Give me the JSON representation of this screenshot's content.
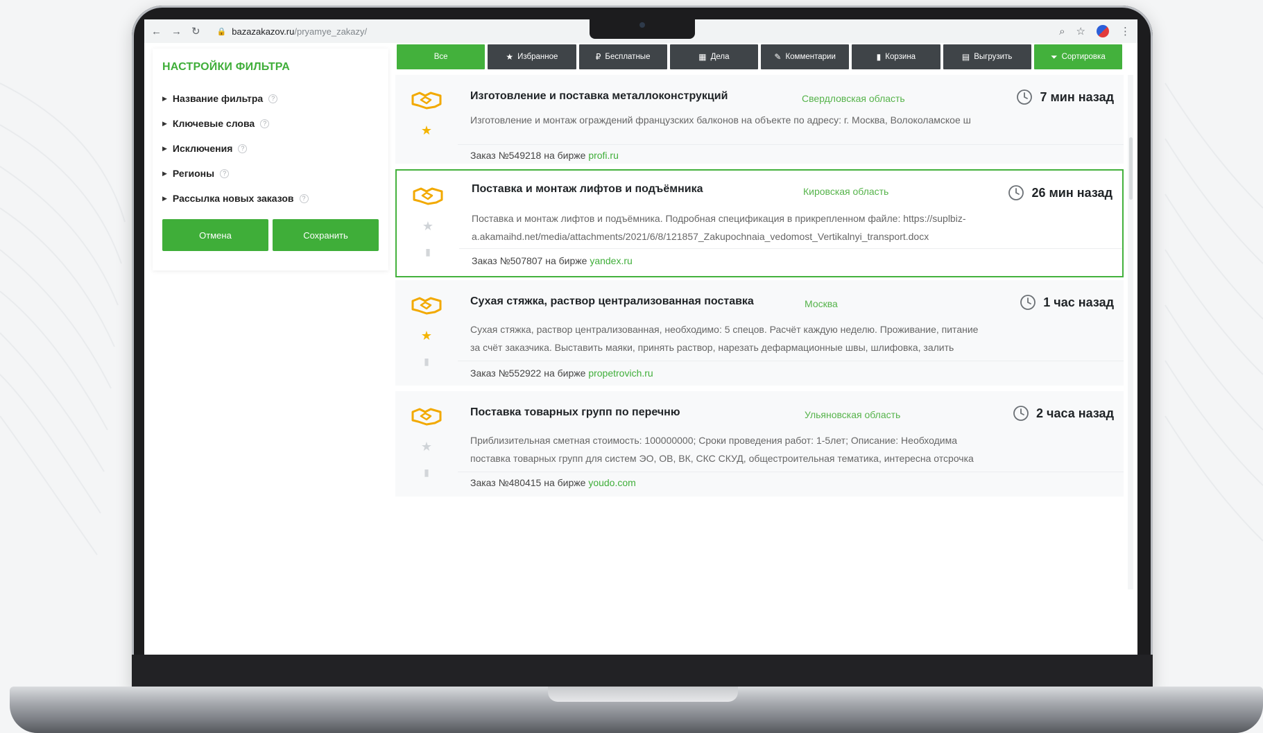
{
  "browser": {
    "url_host": "bazazakazov.ru",
    "url_path": "/pryamye_zakazy/"
  },
  "sidebar": {
    "title": "НАСТРОЙКИ ФИЛЬТРА",
    "items": [
      {
        "label": "Название фильтра"
      },
      {
        "label": "Ключевые слова"
      },
      {
        "label": "Исключения"
      },
      {
        "label": "Регионы"
      },
      {
        "label": "Рассылка новых заказов"
      }
    ],
    "cancel_label": "Отмена",
    "save_label": "Сохранить"
  },
  "toolbar": {
    "buttons": [
      {
        "label": "Все",
        "icon": ""
      },
      {
        "label": "Избранное",
        "icon": "star-icon"
      },
      {
        "label": "Бесплатные",
        "icon": "ruble-icon"
      },
      {
        "label": "Дела",
        "icon": "calendar-icon"
      },
      {
        "label": "Комментарии",
        "icon": "pencil-icon"
      },
      {
        "label": "Корзина",
        "icon": "trash-icon"
      },
      {
        "label": "Выгрузить",
        "icon": "document-icon"
      },
      {
        "label": "Сортировка",
        "icon": "filter-icon"
      }
    ]
  },
  "orders": [
    {
      "title": "Изготовление и поставка металлоконструкций",
      "region": "Свердловская область",
      "time": "7 мин назад",
      "desc_lines": [
        "Изготовление и монтаж ограждений французских балконов на объекте по адресу: г. Москва, Волоколамское ш"
      ],
      "foot_prefix": "Заказ №549218 на бирже ",
      "foot_link": "profi.ru",
      "starred": true
    },
    {
      "title": "Поставка и монтаж лифтов и подъёмника",
      "region": "Кировская область",
      "time": "26 мин назад",
      "desc_lines": [
        "Поставка и монтаж лифтов и подъёмника. Подробная спецификация в прикрепленном файле: https://suplbiz-",
        "a.akamaihd.net/media/attachments/2021/6/8/121857_Zakupochnaia_vedomost_Vertikalnyi_transport.docx"
      ],
      "foot_prefix": "Заказ №507807 на бирже ",
      "foot_link": "yandex.ru",
      "starred": false
    },
    {
      "title": "Сухая стяжка, раствор централизованная поставка",
      "region": "Москва",
      "time": "1 час назад",
      "desc_lines": [
        "Сухая стяжка, раствор централизованная, необходимо: 5 спецов. Расчёт каждую неделю. Проживание, питание",
        "за счёт заказчика. Выставить маяки, принять раствор, нарезать дефармационные швы, шлифовка, залить"
      ],
      "foot_prefix": "Заказ №552922 на бирже ",
      "foot_link": "propetrovich.ru",
      "starred": true
    },
    {
      "title": "Поставка товарных групп по перечню",
      "region": "Ульяновская область",
      "time": "2 часа назад",
      "desc_lines": [
        "Приблизительная сметная стоимость: 100000000; Сроки проведения работ: 1-5лет; Описание: Необходима",
        "поставка товарных групп для систем ЭО, ОВ, ВК, СКС СКУД, общестроительная тематика, интересна отсрочка"
      ],
      "foot_prefix": "Заказ №480415 на бирже ",
      "foot_link": "youdo.com",
      "starred": false
    }
  ],
  "colors": {
    "accent": "#43b13c",
    "toolbar": "#3f4448",
    "star": "#f4b400"
  }
}
